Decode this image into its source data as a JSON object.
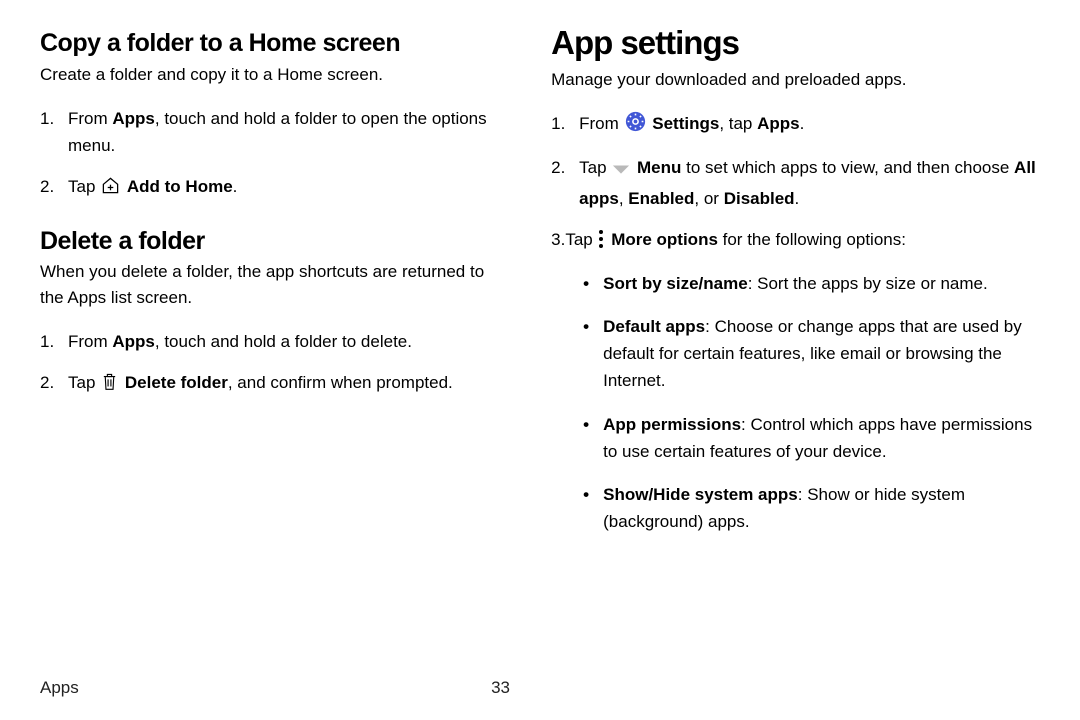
{
  "left": {
    "h1": "Copy a folder to a Home screen",
    "intro": "Create a folder and copy it to a Home screen.",
    "step1_a": "From ",
    "step1_bold": "Apps",
    "step1_b": ", touch and hold a folder to open the options menu.",
    "step2_a": "Tap ",
    "step2_bold": "Add to Home",
    "step2_b": ".",
    "h2": "Delete a folder",
    "intro2": "When you delete a folder, the app shortcuts are returned to the Apps list screen.",
    "d_step1_a": "From ",
    "d_step1_bold": "Apps",
    "d_step1_b": ", touch and hold a folder to delete.",
    "d_step2_a": "Tap ",
    "d_step2_bold": "Delete folder",
    "d_step2_b": ", and confirm when prompted."
  },
  "right": {
    "h1": "App settings",
    "intro": "Manage your downloaded and preloaded apps.",
    "s1_a": "From ",
    "s1_bold1": "Settings",
    "s1_mid": ", tap ",
    "s1_bold2": "Apps",
    "s1_end": ".",
    "s2_a": "Tap ",
    "s2_bold": "Menu",
    "s2_b": " to set which apps to view, and then choose ",
    "s2_bold2": "All apps",
    "s2_c": ", ",
    "s2_bold3": "Enabled",
    "s2_d": ", or ",
    "s2_bold4": "Disabled",
    "s2_e": ".",
    "s3_a": "Tap ",
    "s3_bold": "More options",
    "s3_b": " for the following options:",
    "b1_bold": "Sort by size/name",
    "b1_text": ": Sort the apps by size or name.",
    "b2_bold": "Default apps",
    "b2_text": ": Choose or change apps that are used by default for certain features, like email or browsing the Internet.",
    "b3_bold": "App permissions",
    "b3_text": ": Control which apps have permissions to use certain features of your device.",
    "b4_bold": "Show/Hide system apps",
    "b4_text": ": Show or hide system (background) apps."
  },
  "footer": {
    "section": "Apps",
    "page": "33"
  }
}
